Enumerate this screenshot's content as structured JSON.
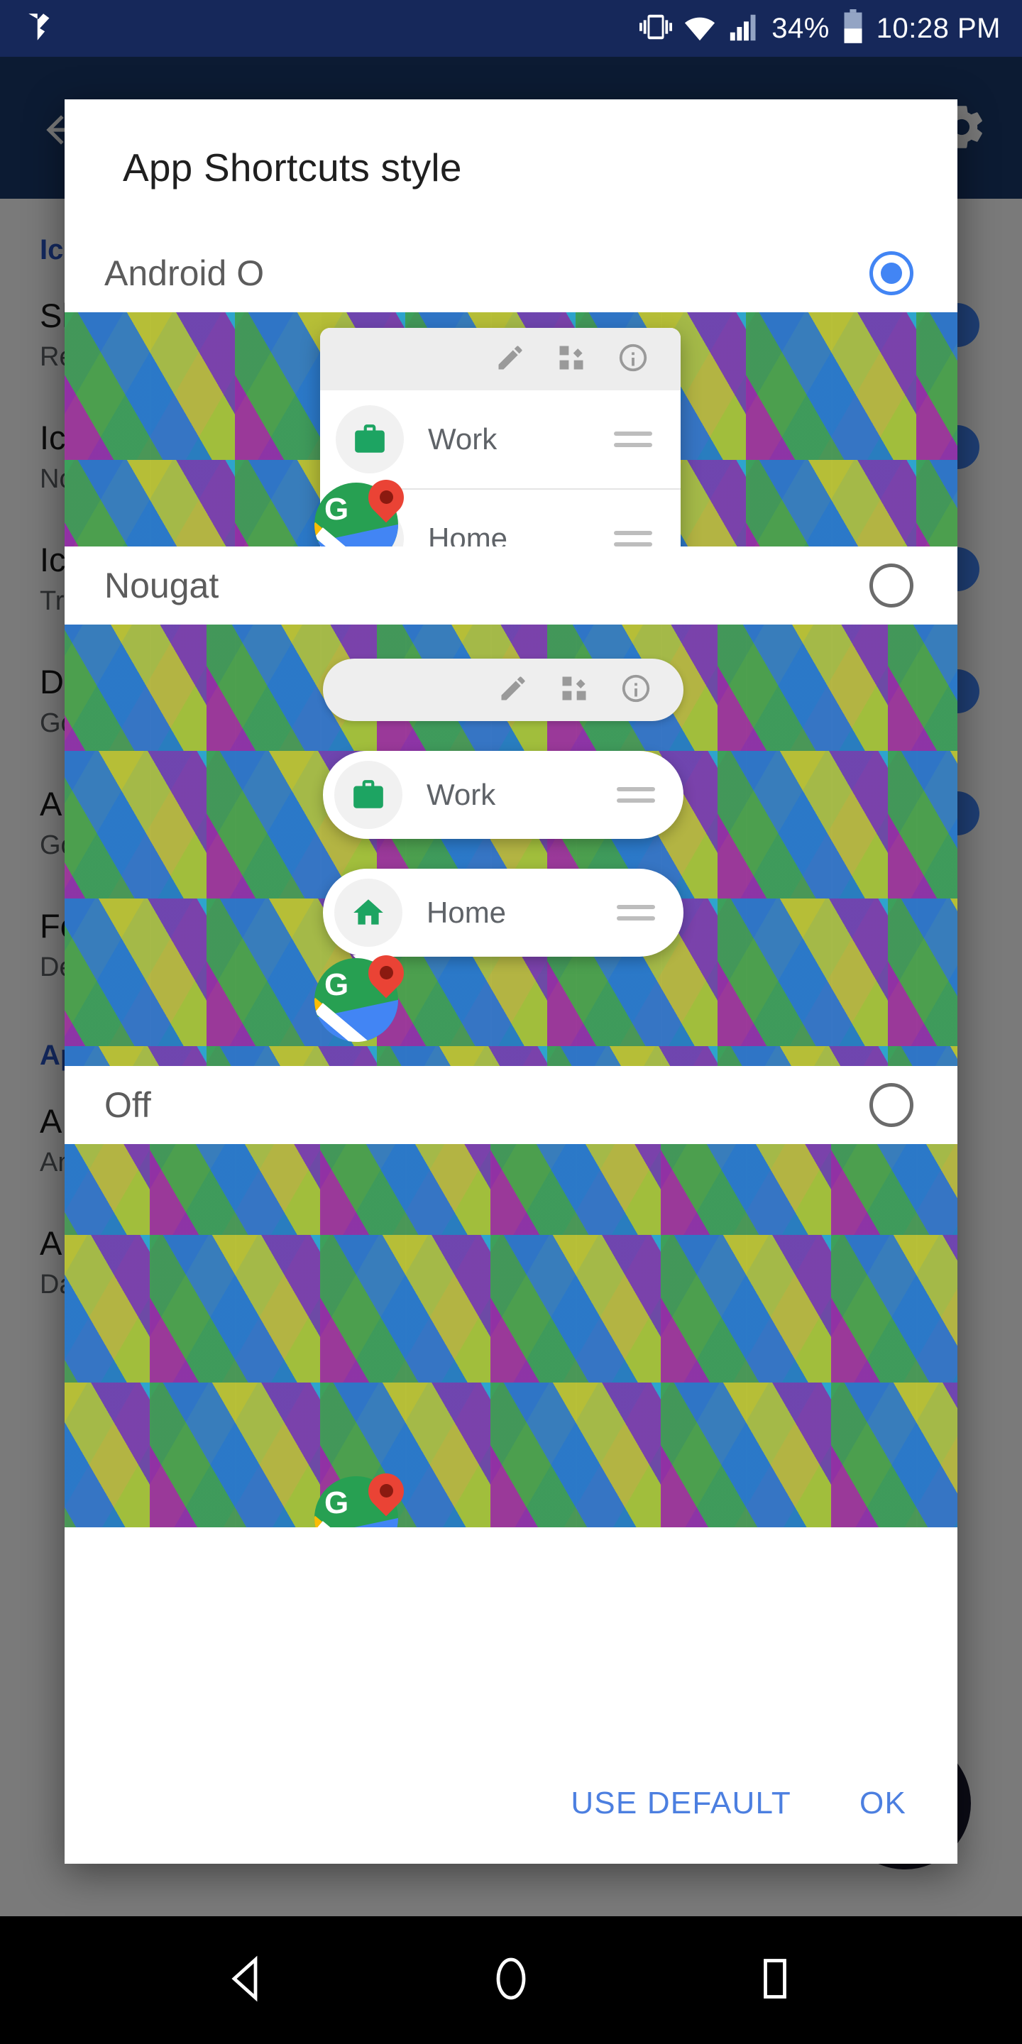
{
  "status_bar": {
    "battery_percent": "34%",
    "time": "10:28 PM",
    "icons": [
      "vibrate-icon",
      "wifi-icon",
      "signal-icon",
      "battery-icon"
    ]
  },
  "dialog": {
    "title": "App Shortcuts style",
    "options": [
      {
        "label": "Android O",
        "selected": true
      },
      {
        "label": "Nougat",
        "selected": false
      },
      {
        "label": "Off",
        "selected": false
      }
    ],
    "buttons": {
      "use_default": "USE DEFAULT",
      "ok": "OK"
    }
  },
  "shortcut_preview": {
    "header_icons": [
      "pencil-icon",
      "widgets-icon",
      "info-icon"
    ],
    "items": [
      {
        "label": "Work",
        "icon": "briefcase-icon"
      },
      {
        "label": "Home",
        "icon": "home-icon"
      }
    ],
    "app_icon": "google-maps-icon",
    "app_icon_letter": "G"
  },
  "background_app": {
    "appbar": {
      "back": "back-arrow-icon",
      "menu": "gear-icon"
    },
    "rows": [
      {
        "kind": "category",
        "title": "Ic"
      },
      {
        "kind": "item",
        "title": "Sh",
        "subtitle": "Re",
        "toggle": true
      },
      {
        "kind": "item",
        "title": "Ic",
        "subtitle": "No",
        "toggle": true
      },
      {
        "kind": "item",
        "title": "Ic",
        "subtitle": "Tr",
        "toggle": true
      },
      {
        "kind": "item",
        "title": "D",
        "subtitle": "Go",
        "toggle": true
      },
      {
        "kind": "item",
        "title": "A",
        "subtitle": "Go",
        "toggle": true
      },
      {
        "kind": "item",
        "title": "Fo",
        "subtitle": "De",
        "toggle": false
      },
      {
        "kind": "category",
        "title": "Ap"
      },
      {
        "kind": "item",
        "title": "A",
        "subtitle": "An",
        "toggle": false
      },
      {
        "kind": "item",
        "title": "A",
        "subtitle": "Da",
        "toggle": false
      }
    ]
  },
  "nav_bar": {
    "back": "nav-back-icon",
    "home": "nav-home-icon",
    "recents": "nav-recents-icon"
  },
  "colors": {
    "accent_blue": "#4285f4",
    "button_blue": "#4c7fe0",
    "statusbar": "#16285a",
    "appbar": "#1b3a6b",
    "green_icon": "#1da462"
  }
}
